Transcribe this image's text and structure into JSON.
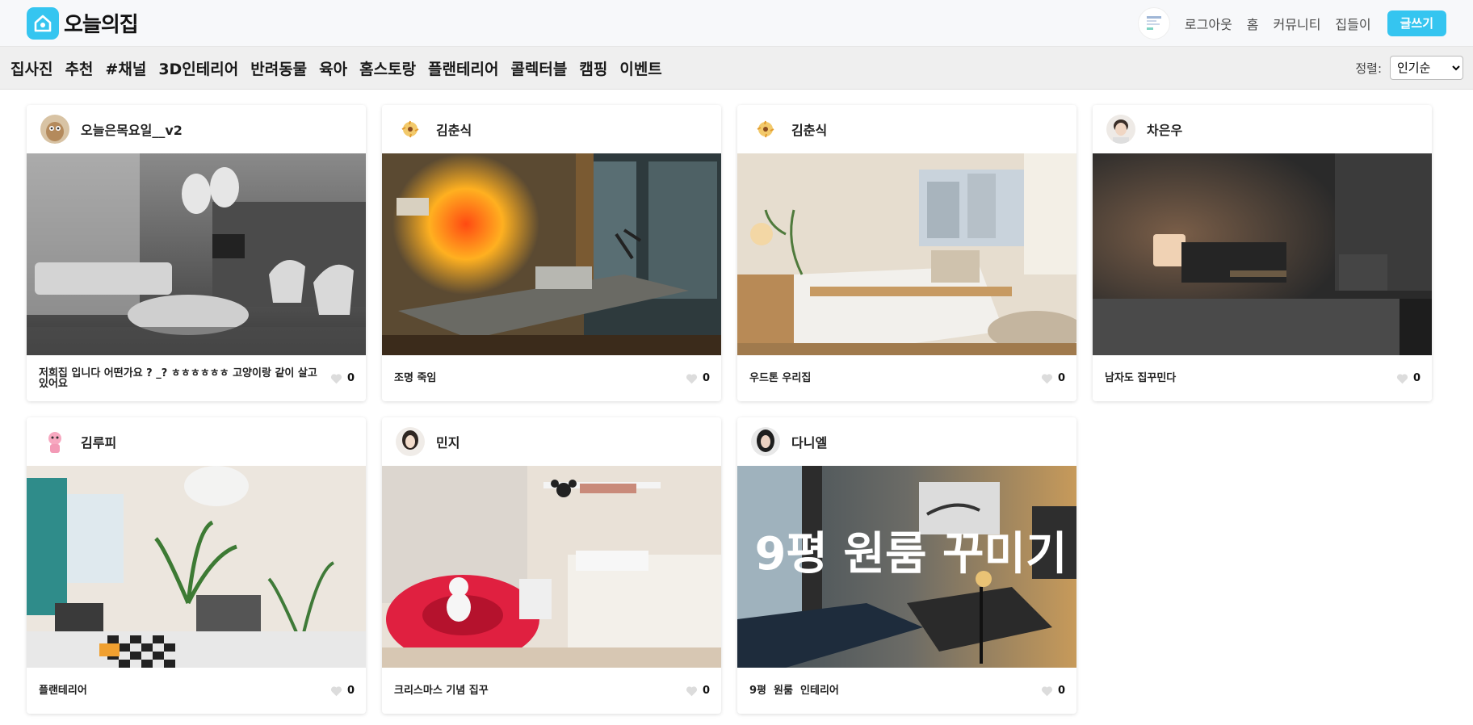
{
  "header": {
    "logo_text": "오늘의집",
    "nav": [
      "로그아웃",
      "홈",
      "커뮤니티",
      "집들이"
    ],
    "write_label": "글쓰기",
    "accent_color": "#35c5f0"
  },
  "categories": [
    "집사진",
    "추천",
    "#채널",
    "3D인테리어",
    "반려동물",
    "육아",
    "홈스토랑",
    "플랜테리어",
    "콜렉터블",
    "캠핑",
    "이벤트"
  ],
  "sort": {
    "label": "정렬:",
    "selected": "인기순"
  },
  "posts": [
    {
      "user": "오늘은목요일__v2",
      "caption": "저희집 입니다 어떤가요 ? _? ㅎㅎㅎㅎㅎㅎ 고양이랑 같이 살고 있어요",
      "likes": "0"
    },
    {
      "user": "김춘식",
      "caption": "조명 죽임",
      "likes": "0"
    },
    {
      "user": "김춘식",
      "caption": "우드톤 우리집",
      "likes": "0"
    },
    {
      "user": "차은우",
      "caption": "남자도 집꾸민다",
      "likes": "0"
    },
    {
      "user": "김루피",
      "caption": "플랜테리어",
      "likes": "0"
    },
    {
      "user": "민지",
      "caption": "크리스마스 기념 집꾸",
      "likes": "0"
    },
    {
      "user": "다니엘",
      "caption": "9평  원룸  인테리어",
      "likes": "0",
      "photo_overlay": "9평 원룸 꾸미기"
    }
  ]
}
